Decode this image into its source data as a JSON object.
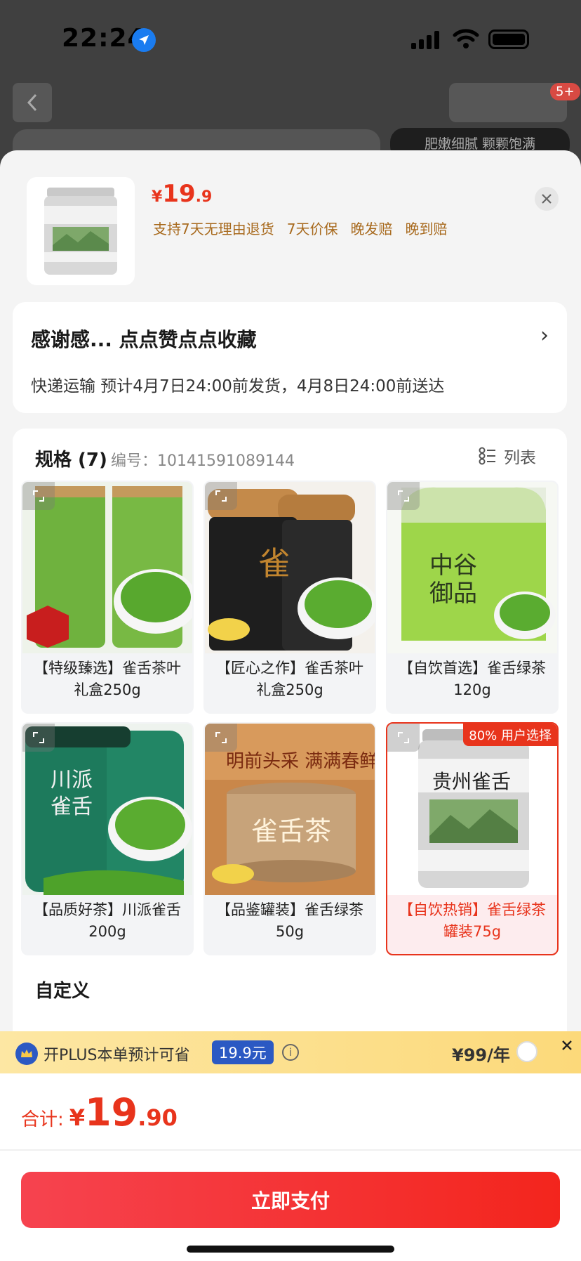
{
  "status": {
    "time": "22:24"
  },
  "background": {
    "badge": "5+",
    "banner": "肥嫩细腻 颗颗饱满"
  },
  "product": {
    "price_yen": "¥",
    "price_int": "19",
    "price_dec": ".9",
    "guarantees": [
      "支持7天无理由退货",
      "7天价保",
      "晚发赔",
      "晚到赔"
    ]
  },
  "address": {
    "title": "感谢感... 点点赞点点收藏",
    "shipping": "快递运输 预计4月7日24:00前发货，4月8日24:00前送达"
  },
  "spec": {
    "title": "规格 (7)",
    "code": "编号：10141591089144",
    "list_label": "列表",
    "items": [
      {
        "label": "【特级臻选】雀舌茶叶礼盒250g"
      },
      {
        "label": "【匠心之作】雀舌茶叶礼盒250g"
      },
      {
        "label": "【自饮首选】雀舌绿茶120g"
      },
      {
        "label": "【品质好茶】川派雀舌200g"
      },
      {
        "label": "【品鉴罐装】雀舌绿茶50g"
      },
      {
        "label": "【自饮热销】雀舌绿茶罐装75g",
        "tag": "80% 用户选择",
        "selected": true
      }
    ],
    "custom_title": "自定义"
  },
  "plus": {
    "text": "开PLUS本单预计可省",
    "amount": "19.9元",
    "price": "¥99/年"
  },
  "footer": {
    "total_label": "合计:",
    "total_yen": "¥",
    "total_int": "19",
    "total_dec": ".90",
    "pay_label": "立即支付"
  },
  "colors": {
    "accent": "#e8341c",
    "plus_blue": "#2b59c3",
    "guarantee": "#a86a1e"
  }
}
